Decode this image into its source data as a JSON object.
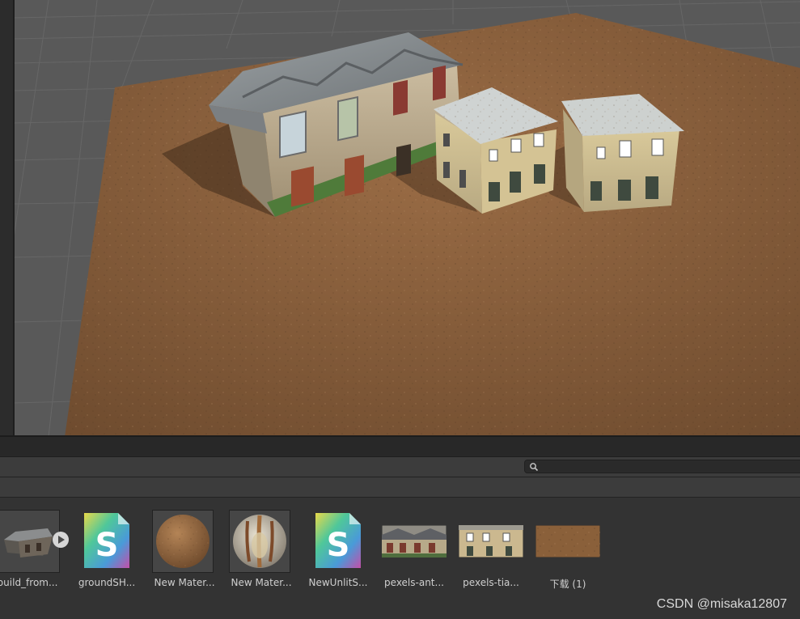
{
  "project_panel": {
    "search": {
      "value": "",
      "placeholder": ""
    },
    "assets": [
      {
        "label": "build_from...",
        "type": "model"
      },
      {
        "label": "groundSH...",
        "type": "shader-graph"
      },
      {
        "label": "New Mater...",
        "type": "material-ground"
      },
      {
        "label": "New Mater...",
        "type": "material-building"
      },
      {
        "label": "NewUnlitS...",
        "type": "shader-graph"
      },
      {
        "label": "pexels-ant...",
        "type": "texture"
      },
      {
        "label": "pexels-tia...",
        "type": "texture"
      },
      {
        "label": "下载 (1)",
        "type": "texture"
      }
    ]
  },
  "watermark": "CSDN @misaka12807",
  "colors": {
    "panel_bg": "#333333",
    "toolbar_bg": "#3c3c3c",
    "scene_bg": "#595959",
    "ground": "#8a603a"
  },
  "icons": [
    "search-icon",
    "play-icon",
    "shader-graph-icon"
  ]
}
